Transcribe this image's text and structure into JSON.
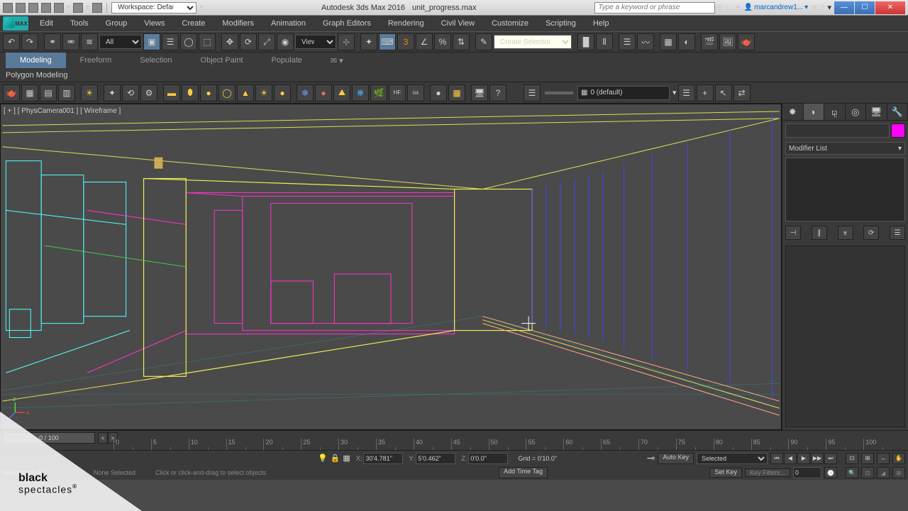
{
  "titlebar": {
    "workspace_label": "Workspace: Default",
    "app_title": "Autodesk 3ds Max 2016",
    "filename": "unit_progress.max",
    "search_placeholder": "Type a keyword or phrase",
    "user": "marcandrew1..."
  },
  "menubar": {
    "logo": "MAX",
    "items": [
      "Edit",
      "Tools",
      "Group",
      "Views",
      "Create",
      "Modifiers",
      "Animation",
      "Graph Editors",
      "Rendering",
      "Civil View",
      "Customize",
      "Scripting",
      "Help"
    ]
  },
  "main_toolbar": {
    "filter_dd": "All",
    "refcoord_dd": "View",
    "named_sel": "Create Selection Se"
  },
  "ribbon": {
    "tabs": [
      "Modeling",
      "Freeform",
      "Selection",
      "Object Paint",
      "Populate"
    ],
    "active": 0,
    "subpanel": "Polygon Modeling"
  },
  "layer_dd": "0 (default)",
  "viewport": {
    "label": "[ + ] [ PhysCamera001 ] [ Wireframe ]"
  },
  "cmd_panel": {
    "modifier_list": "Modifier List"
  },
  "timeline": {
    "slider": "0 / 100",
    "ticks": [
      "0",
      "5",
      "10",
      "15",
      "20",
      "25",
      "30",
      "35",
      "40",
      "45",
      "50",
      "55",
      "60",
      "65",
      "70",
      "75",
      "80",
      "85",
      "90",
      "95",
      "100"
    ]
  },
  "status": {
    "x": "30'4.781\"",
    "y": "5'0.462\"",
    "z": "0'0.0\"",
    "grid": "Grid = 0'10.0\"",
    "addtime": "Add Time Tag",
    "autokey": "Auto Key",
    "selected_dd": "Selected",
    "setkey": "Set Key",
    "keyfilters": "Key Filters...",
    "none_selected": "None Selected",
    "hint": "Click or click-and-drag to select objects",
    "welcome": "Welcome to M..."
  },
  "watermark": {
    "line1": "black",
    "line2": "spectacles"
  }
}
